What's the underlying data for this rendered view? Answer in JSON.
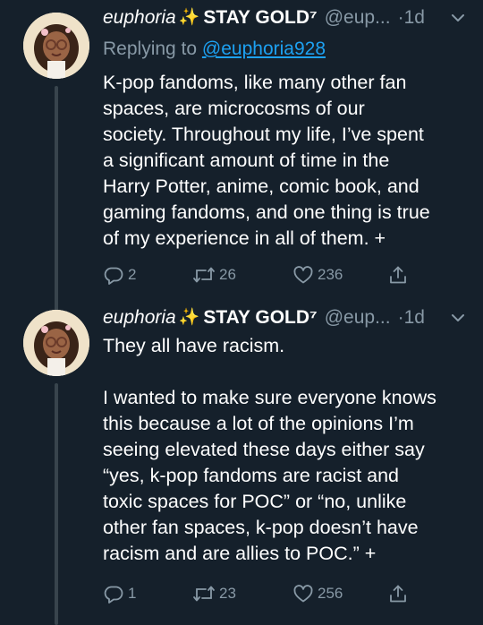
{
  "tweets": [
    {
      "display_name": "euphoria",
      "name_emoji": "✨",
      "name_suffix": "STAY GOLD⁷",
      "handle": "@eup...",
      "separator": "·",
      "time": "1d",
      "reply_prefix": "Replying to",
      "reply_handle": "@euphoria928",
      "text": "K-pop fandoms, like many other fan\nspaces, are microcosms of our\nsociety. Throughout my life, I’ve spent\na significant amount of time in the\nHarry Potter, anime, comic book, and\ngaming fandoms, and one thing is true\nof my experience in all of them. +",
      "replies": "2",
      "retweets": "26",
      "likes": "236"
    },
    {
      "display_name": "euphoria",
      "name_emoji": "✨",
      "name_suffix": "STAY GOLD⁷",
      "handle": "@eup...",
      "separator": "·",
      "time": "1d",
      "text": "They all have racism.\n\nI wanted to make sure everyone knows\nthis because a lot of the opinions I’m\nseeing elevated these days either say\n“yes, k-pop fandoms are racist and\ntoxic spaces for POC” or “no, unlike\nother fan spaces, k-pop doesn’t have\nracism and are allies to POC.” +",
      "replies": "1",
      "retweets": "23",
      "likes": "256"
    }
  ],
  "colors": {
    "background": "#15202b",
    "secondary_text": "#8899a6",
    "link": "#1da1f2",
    "thread_line": "#38444d"
  },
  "icons": [
    "reply-icon",
    "retweet-icon",
    "like-icon",
    "share-icon",
    "chevron-down-icon",
    "sparkles-icon"
  ]
}
